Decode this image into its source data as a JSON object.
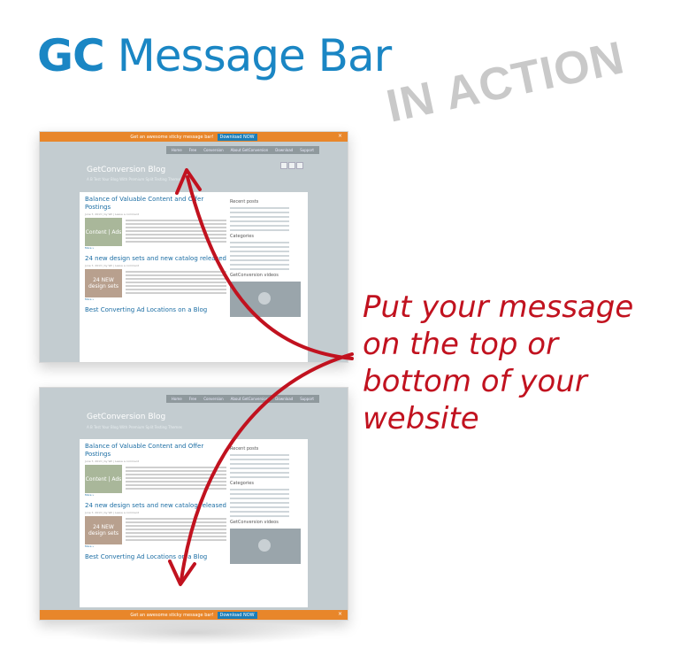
{
  "headline": {
    "gc": "GC",
    "rest": "Message Bar"
  },
  "stamp": "IN ACTION",
  "callout": "Put your message on the top or bottom of your website",
  "message_bar": {
    "text": "Get an awesome sticky message bar!",
    "button": "Download NOW",
    "close": "×"
  },
  "blog": {
    "nav": [
      "Home",
      "Free",
      "Conversion",
      "About GetConversion",
      "Download",
      "Support"
    ],
    "title": "GetConversion Blog",
    "tagline": "A B Test Your Blog With Premium Split Testing Themes",
    "posts": [
      {
        "title": "Balance of Valuable Content and Offer Postings",
        "meta": "June 7, 2013 | by Wil | Leave a comment",
        "thumb": "Content | Ads",
        "more": "More »"
      },
      {
        "title": "24 new design sets and new catalog released",
        "meta": "June 7, 2013 | by Wil | Leave a comment",
        "thumb": "24 NEW design sets",
        "more": "More »"
      },
      {
        "title": "Best Converting Ad Locations on a Blog",
        "meta": ""
      }
    ],
    "sidebar": {
      "recent": "Recent posts",
      "categories": "Categories",
      "videos": "GetConversion videos"
    }
  },
  "colors": {
    "brand_blue": "#1a86c4",
    "stamp_gray": "#c9c9c9",
    "callout_red": "#c1121f",
    "bar_orange": "#e8862a"
  }
}
